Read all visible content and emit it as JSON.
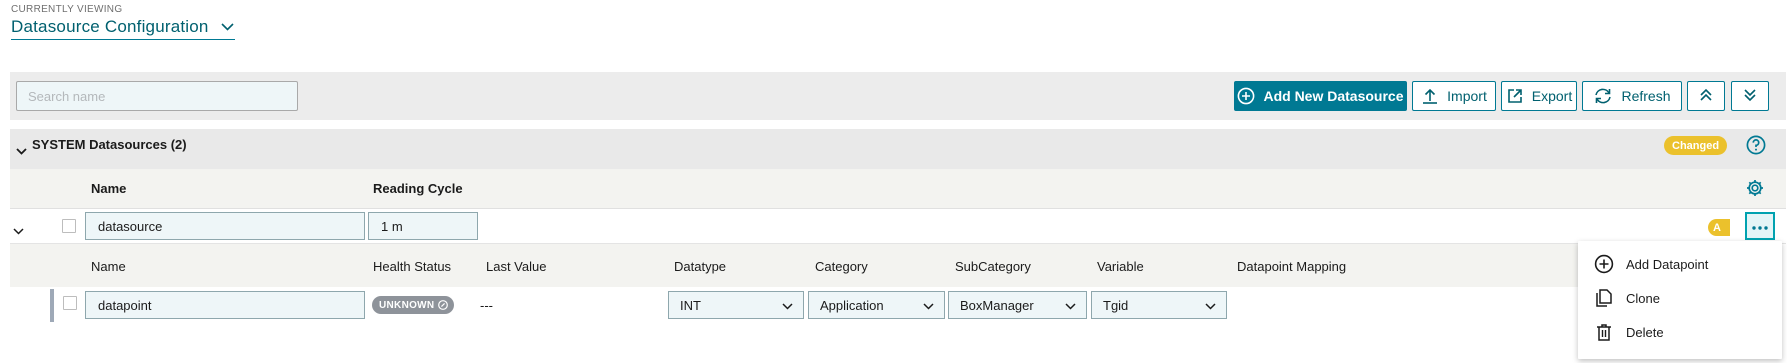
{
  "header": {
    "viewing_label": "CURRENTLY VIEWING",
    "title": "Datasource Configuration"
  },
  "toolbar": {
    "search_placeholder": "Search name",
    "add_label": "Add New Datasource",
    "import_label": "Import",
    "export_label": "Export",
    "refresh_label": "Refresh"
  },
  "group": {
    "title": "SYSTEM Datasources (2)",
    "badge": "Changed"
  },
  "columns": {
    "name": "Name",
    "reading_cycle": "Reading Cycle"
  },
  "datasource": {
    "name": "datasource",
    "reading_cycle": "1 m",
    "badge": "A"
  },
  "datapoint_columns": {
    "name": "Name",
    "health": "Health Status",
    "last_value": "Last Value",
    "datatype": "Datatype",
    "category": "Category",
    "subcategory": "SubCategory",
    "variable": "Variable",
    "mapping": "Datapoint Mapping"
  },
  "datapoint": {
    "name": "datapoint",
    "health": "UNKNOWN",
    "last_value": "---",
    "datatype": "INT",
    "category": "Application",
    "subcategory": "BoxManager",
    "variable": "Tgid"
  },
  "menu": {
    "items": [
      "Add Datapoint",
      "Clone",
      "Delete"
    ]
  },
  "colors": {
    "accent": "#007993",
    "changed_badge": "#ebc12c",
    "unknown_badge": "#8e939a"
  },
  "icons": [
    "chevron-down-icon",
    "add-circle-icon",
    "upload-icon",
    "export-icon",
    "refresh-icon",
    "double-chevron-up-icon",
    "double-chevron-down-icon",
    "help-icon",
    "gear-icon",
    "more-icon",
    "clone-icon",
    "trash-icon"
  ]
}
